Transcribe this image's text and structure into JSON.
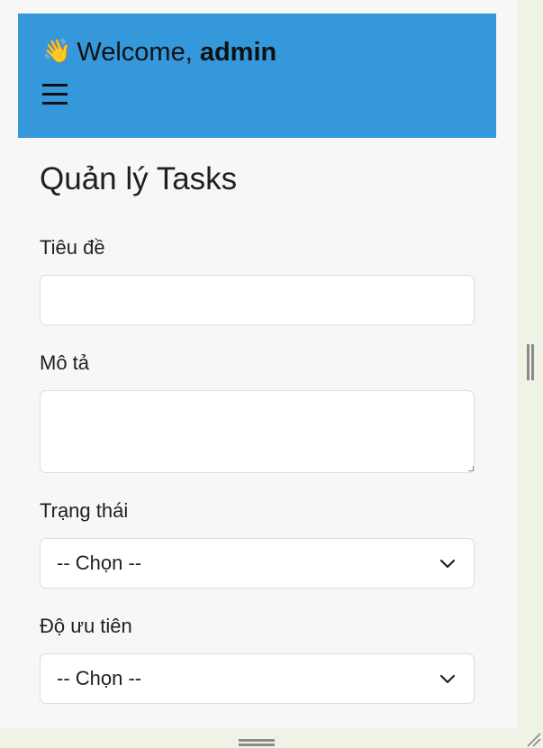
{
  "header": {
    "wave_icon": "👋",
    "welcome_prefix": "Welcome, ",
    "username": "admin",
    "background_color": "#3498db",
    "menu_icon": "hamburger-menu-icon"
  },
  "page": {
    "title": "Quản lý Tasks"
  },
  "form": {
    "title_label": "Tiêu đề",
    "title_value": "",
    "description_label": "Mô tả",
    "description_value": "",
    "status_label": "Trạng thái",
    "status_selected": "-- Chọn --",
    "priority_label": "Độ ưu tiên",
    "priority_selected": "-- Chọn --"
  }
}
